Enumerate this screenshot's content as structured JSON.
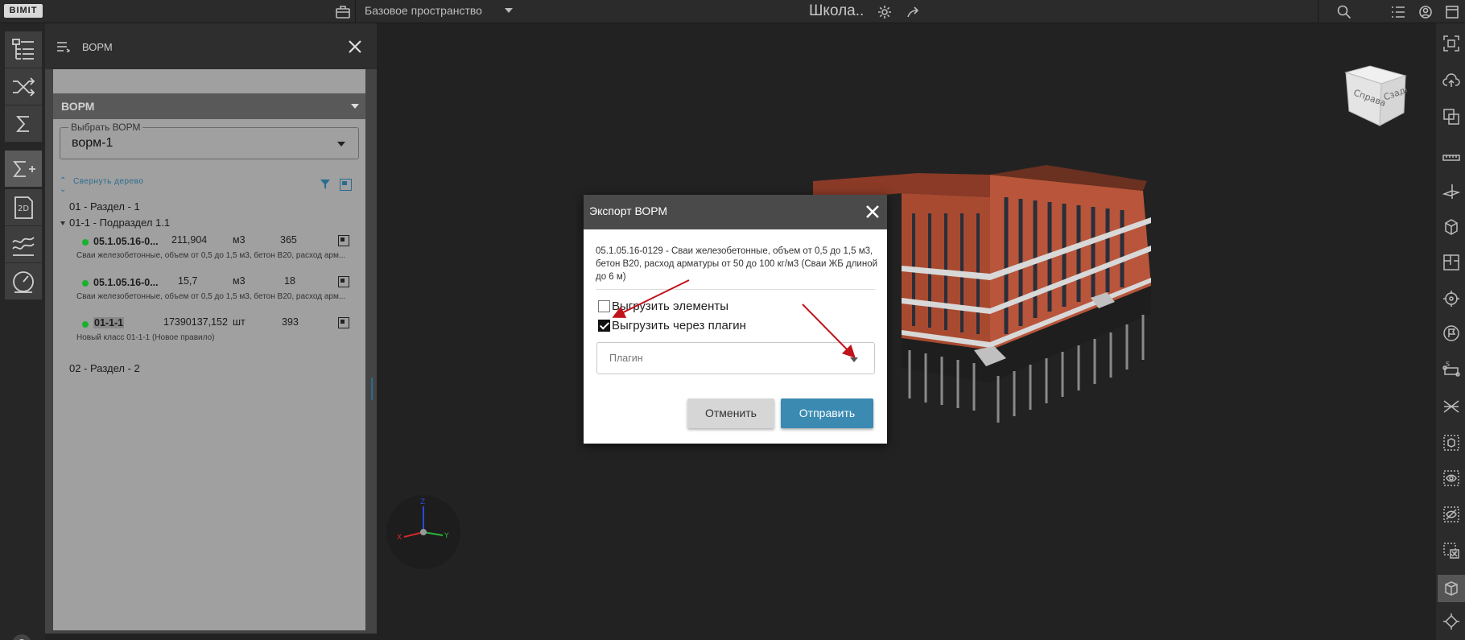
{
  "topbar": {
    "logo": "BIMIT",
    "space_name": "Базовое пространство",
    "project_title": "Школа.."
  },
  "panel": {
    "title": "ВОРМ",
    "section_label": "ВОРМ",
    "select_label": "Выбрать ВОРМ",
    "select_value": "ворм-1",
    "collapse_label": "Свернуть дерево",
    "tree": {
      "section1": "01 - Раздел - 1",
      "subsection1": "01-1 - Подраздел 1.1",
      "rows": [
        {
          "code": "05.1.05.16-0...",
          "value": "211,904",
          "unit": "м3",
          "count": "365",
          "desc": "Сваи железобетонные, объем от 0,5 до 1,5 м3, бетон В20, расход арм..."
        },
        {
          "code": "05.1.05.16-0...",
          "value": "15,7",
          "unit": "м3",
          "count": "18",
          "desc": "Сваи железобетонные, объем от 0,5 до 1,5 м3, бетон В20, расход арм..."
        },
        {
          "code": "01-1-1",
          "value": "17390137,152",
          "unit": "шт",
          "count": "393",
          "desc": "Новый класс 01-1-1 (Новое правило)"
        }
      ],
      "section2": "02 - Раздел - 2"
    }
  },
  "navcube": {
    "front": "Справа",
    "side": "Сзади"
  },
  "gizmo": {
    "x": "X",
    "y": "Y",
    "z": "Z"
  },
  "dialog": {
    "title": "Экспорт ВОРМ",
    "description": "05.1.05.16-0129 - Сваи железобетонные, объем от 0,5 до 1,5 м3, бетон В20, расход арматуры от 50 до 100 кг/м3 (Сваи ЖБ длиной до 6 м)",
    "checkbox_elements": {
      "label": "Выгрузить элементы",
      "checked": false
    },
    "checkbox_plugin": {
      "label": "Выгрузить через плагин",
      "checked": true
    },
    "plugin_placeholder": "Плагин",
    "cancel_label": "Отменить",
    "send_label": "Отправить"
  },
  "help_label": "?",
  "colors": {
    "accent": "#3a8ab2",
    "status_dot": "#19b22d",
    "annotation_arrow": "#c0141a",
    "building_brick": "#b8553a"
  }
}
